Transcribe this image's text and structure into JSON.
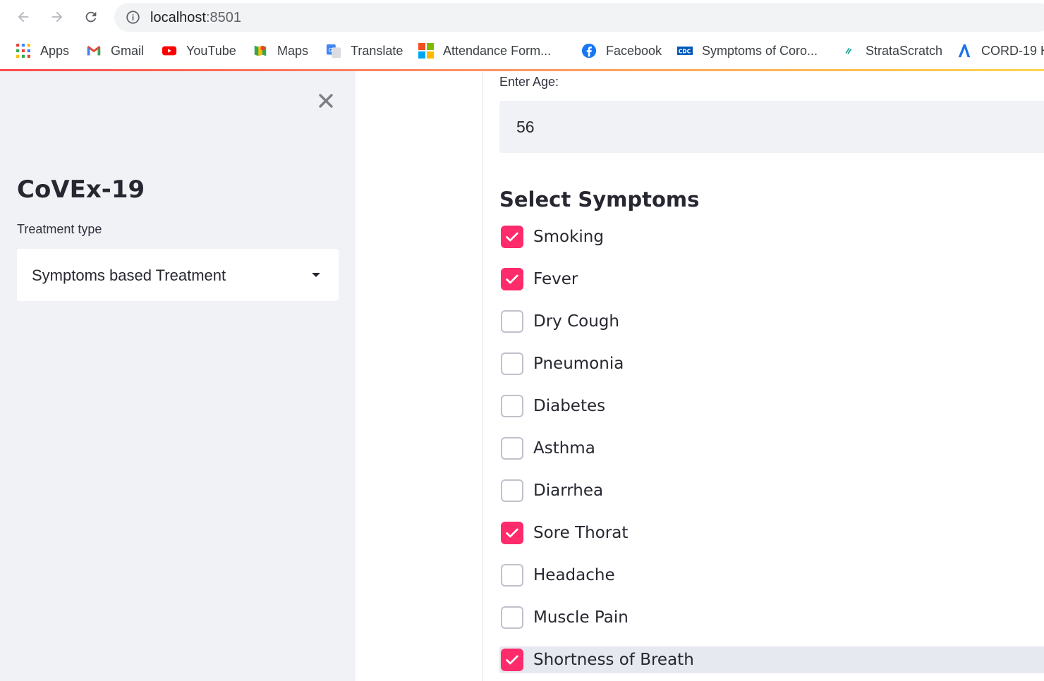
{
  "browser": {
    "url_host": "localhost",
    "url_port": ":8501",
    "bookmarks": [
      {
        "label": "Apps",
        "icon": "apps-grid-icon"
      },
      {
        "label": "Gmail",
        "icon": "gmail-icon"
      },
      {
        "label": "YouTube",
        "icon": "youtube-icon"
      },
      {
        "label": "Maps",
        "icon": "maps-icon"
      },
      {
        "label": "Translate",
        "icon": "translate-icon"
      },
      {
        "label": "Attendance Form...",
        "icon": "microsoft-icon"
      },
      {
        "label": "Facebook",
        "icon": "facebook-icon"
      },
      {
        "label": "Symptoms of Coro...",
        "icon": "cdc-icon"
      },
      {
        "label": "StrataScratch",
        "icon": "stratascratch-icon"
      },
      {
        "label": "CORD-19 H",
        "icon": "cord19-icon"
      }
    ]
  },
  "sidebar": {
    "title": "CoVEx-19",
    "treatment_label": "Treatment type",
    "treatment_value": "Symptoms based Treatment"
  },
  "main": {
    "age_label": "Enter Age:",
    "age_value": "56",
    "symptoms_title": "Select Symptoms",
    "symptoms": [
      {
        "label": "Smoking",
        "checked": true
      },
      {
        "label": "Fever",
        "checked": true
      },
      {
        "label": "Dry Cough",
        "checked": false
      },
      {
        "label": "Pneumonia",
        "checked": false
      },
      {
        "label": "Diabetes",
        "checked": false
      },
      {
        "label": "Asthma",
        "checked": false
      },
      {
        "label": "Diarrhea",
        "checked": false
      },
      {
        "label": "Sore Thorat",
        "checked": true
      },
      {
        "label": "Headache",
        "checked": false
      },
      {
        "label": "Muscle Pain",
        "checked": false
      },
      {
        "label": "Shortness of Breath",
        "checked": true
      }
    ]
  },
  "colors": {
    "accent": "#ff2b6b",
    "sidebar_bg": "#f0f2f6"
  }
}
